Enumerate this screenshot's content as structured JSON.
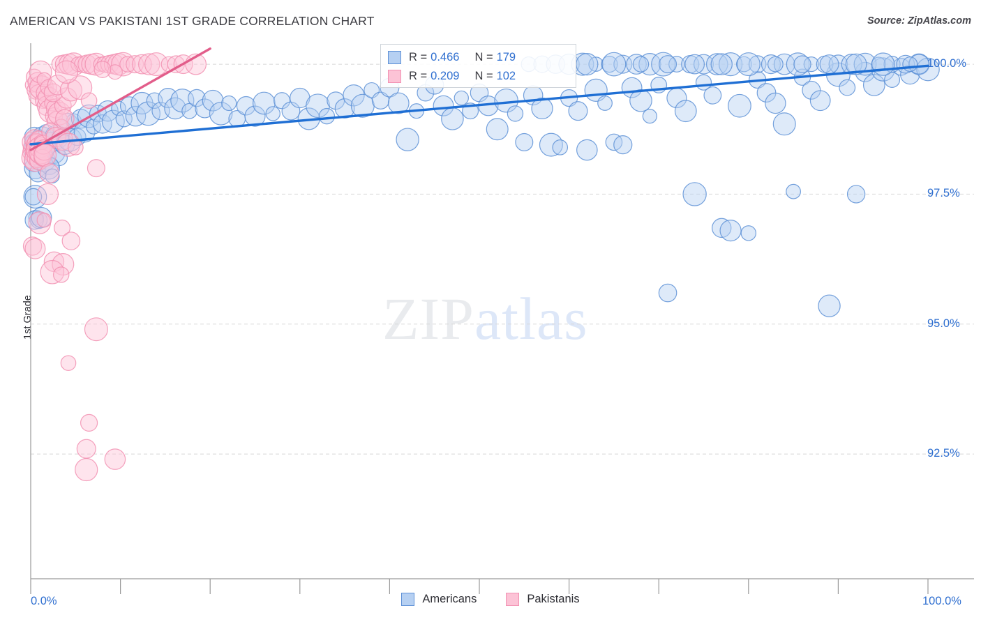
{
  "title": "AMERICAN VS PAKISTANI 1ST GRADE CORRELATION CHART",
  "source": "Source: ZipAtlas.com",
  "watermark": {
    "part1": "ZIP",
    "part2": "atlas"
  },
  "legend_stats": {
    "rows": [
      {
        "series": "Americans",
        "color": "#b6d0f2",
        "border": "#5d90d6",
        "r_label": "R =",
        "r_value": "0.466",
        "n_label": "N =",
        "n_value": "179"
      },
      {
        "series": "Pakistanis",
        "color": "#fcc3d6",
        "border": "#f291b2",
        "r_label": "R =",
        "r_value": "0.209",
        "n_label": "N =",
        "n_value": "102"
      }
    ]
  },
  "bottom_legend": [
    {
      "label": "Americans",
      "color": "#b6d0f2",
      "border": "#5d90d6"
    },
    {
      "label": "Pakistanis",
      "color": "#fcc3d6",
      "border": "#f291b2"
    }
  ],
  "axes": {
    "y_title": "1st Grade",
    "y_ticks": [
      "100.0%",
      "97.5%",
      "95.0%",
      "92.5%"
    ],
    "x_ticks": [
      "0.0%",
      "100.0%"
    ]
  },
  "chart_data": {
    "type": "scatter",
    "title": "AMERICAN VS PAKISTANI 1ST GRADE CORRELATION CHART",
    "xlabel": "",
    "ylabel": "1st Grade",
    "xlim": [
      0,
      100
    ],
    "ylim": [
      90.1,
      100.35
    ],
    "grid": true,
    "legend_position": "bottom",
    "y_gridlines": [
      100.0,
      97.5,
      95.0,
      92.5
    ],
    "x_tick_values": [
      0,
      10,
      20,
      30,
      40,
      50,
      60,
      70,
      80,
      90,
      100
    ],
    "series": [
      {
        "name": "Americans",
        "color": "#b6d0f2",
        "border": "#5d90d6",
        "R": 0.466,
        "N": 179,
        "trendline": {
          "x0": 0,
          "y0": 98.46,
          "x1": 100,
          "y1": 99.97,
          "color": "#1f6fd4"
        },
        "points": [
          [
            0.1,
            98.3
          ],
          [
            0.2,
            98.5
          ],
          [
            0.3,
            98.1
          ],
          [
            0.4,
            98.6
          ],
          [
            0.5,
            98.0
          ],
          [
            0.6,
            98.45
          ],
          [
            0.7,
            98.25
          ],
          [
            0.8,
            97.9
          ],
          [
            0.9,
            98.55
          ],
          [
            1.0,
            98.35
          ],
          [
            0.5,
            97.45
          ],
          [
            0.6,
            97.05
          ],
          [
            0.9,
            97.0
          ],
          [
            1.1,
            98.2
          ],
          [
            1.3,
            98.6
          ],
          [
            1.5,
            98.15
          ],
          [
            1.7,
            98.7
          ],
          [
            1.9,
            98.4
          ],
          [
            2.1,
            98.05
          ],
          [
            2.3,
            98.5
          ],
          [
            2.6,
            98.3
          ],
          [
            2.9,
            98.6
          ],
          [
            3.2,
            98.2
          ],
          [
            3.5,
            98.75
          ],
          [
            3.8,
            98.45
          ],
          [
            4.1,
            98.85
          ],
          [
            4.4,
            98.55
          ],
          [
            4.8,
            98.9
          ],
          [
            5.2,
            98.6
          ],
          [
            5.6,
            98.95
          ],
          [
            6.0,
            98.7
          ],
          [
            6.5,
            99.0
          ],
          [
            7.0,
            98.8
          ],
          [
            7.5,
            99.05
          ],
          [
            8.0,
            98.85
          ],
          [
            8.6,
            99.1
          ],
          [
            9.2,
            98.9
          ],
          [
            9.8,
            99.15
          ],
          [
            10.4,
            98.95
          ],
          [
            11.0,
            99.2
          ],
          [
            11.7,
            99.0
          ],
          [
            12.4,
            99.25
          ],
          [
            13.1,
            99.05
          ],
          [
            13.8,
            99.3
          ],
          [
            14.5,
            99.1
          ],
          [
            15.3,
            99.35
          ],
          [
            16.1,
            99.15
          ],
          [
            16.9,
            99.3
          ],
          [
            17.7,
            99.1
          ],
          [
            18.5,
            99.35
          ],
          [
            19.4,
            99.15
          ],
          [
            20.3,
            99.3
          ],
          [
            21.2,
            99.05
          ],
          [
            22.1,
            99.25
          ],
          [
            23.0,
            98.95
          ],
          [
            24.0,
            99.2
          ],
          [
            25.0,
            99.0
          ],
          [
            26.0,
            99.25
          ],
          [
            27.0,
            99.05
          ],
          [
            28.0,
            99.3
          ],
          [
            29.0,
            99.1
          ],
          [
            30.0,
            99.35
          ],
          [
            31.0,
            98.95
          ],
          [
            32.0,
            99.2
          ],
          [
            33.0,
            99.0
          ],
          [
            34.0,
            99.3
          ],
          [
            35.0,
            99.15
          ],
          [
            36.0,
            99.4
          ],
          [
            37.0,
            99.2
          ],
          [
            38.0,
            99.5
          ],
          [
            39.0,
            99.3
          ],
          [
            40.0,
            99.55
          ],
          [
            41.0,
            99.25
          ],
          [
            42.0,
            98.55
          ],
          [
            43.0,
            99.1
          ],
          [
            44.0,
            99.45
          ],
          [
            45.0,
            99.6
          ],
          [
            46.0,
            99.2
          ],
          [
            47.0,
            98.95
          ],
          [
            48.0,
            99.35
          ],
          [
            49.0,
            99.1
          ],
          [
            50.0,
            99.45
          ],
          [
            51.0,
            99.2
          ],
          [
            52.0,
            98.75
          ],
          [
            53.0,
            99.3
          ],
          [
            54.0,
            99.05
          ],
          [
            55.0,
            98.5
          ],
          [
            56.0,
            99.4
          ],
          [
            57.0,
            99.15
          ],
          [
            58.0,
            98.45
          ],
          [
            59.0,
            98.4
          ],
          [
            60.0,
            99.35
          ],
          [
            61.0,
            99.1
          ],
          [
            62.0,
            98.35
          ],
          [
            63.0,
            99.5
          ],
          [
            64.0,
            99.25
          ],
          [
            65.0,
            98.5
          ],
          [
            66.0,
            98.45
          ],
          [
            67.0,
            99.55
          ],
          [
            68.0,
            99.3
          ],
          [
            69.0,
            99.0
          ],
          [
            70.0,
            99.6
          ],
          [
            71.0,
            95.6
          ],
          [
            72.0,
            99.35
          ],
          [
            73.0,
            99.1
          ],
          [
            74.0,
            97.5
          ],
          [
            75.0,
            99.65
          ],
          [
            76.0,
            99.4
          ],
          [
            77.0,
            96.85
          ],
          [
            78.0,
            96.8
          ],
          [
            79.0,
            99.2
          ],
          [
            80.0,
            96.75
          ],
          [
            81.0,
            99.7
          ],
          [
            82.0,
            99.45
          ],
          [
            83.0,
            99.25
          ],
          [
            84.0,
            98.85
          ],
          [
            85.0,
            97.55
          ],
          [
            86.0,
            99.75
          ],
          [
            87.0,
            99.5
          ],
          [
            88.0,
            99.3
          ],
          [
            89.0,
            95.35
          ],
          [
            90.0,
            99.8
          ],
          [
            91.0,
            99.55
          ],
          [
            92.0,
            97.5
          ],
          [
            93.0,
            99.85
          ],
          [
            94.0,
            99.6
          ],
          [
            95.0,
            99.9
          ],
          [
            96.0,
            99.7
          ],
          [
            97.0,
            99.95
          ],
          [
            98.0,
            99.8
          ],
          [
            99.0,
            100.0
          ],
          [
            100.0,
            99.9
          ],
          [
            55.5,
            100.0
          ],
          [
            57.0,
            100.0
          ],
          [
            58.5,
            100.0
          ],
          [
            60.0,
            100.0
          ],
          [
            61.5,
            100.0
          ],
          [
            63.0,
            100.0
          ],
          [
            64.5,
            100.0
          ],
          [
            66.0,
            100.0
          ],
          [
            67.5,
            100.0
          ],
          [
            69.0,
            100.0
          ],
          [
            70.5,
            100.0
          ],
          [
            72.0,
            100.0
          ],
          [
            73.5,
            100.0
          ],
          [
            75.0,
            100.0
          ],
          [
            76.5,
            100.0
          ],
          [
            78.0,
            100.0
          ],
          [
            79.5,
            100.0
          ],
          [
            81.0,
            100.0
          ],
          [
            82.5,
            100.0
          ],
          [
            84.0,
            100.0
          ],
          [
            85.5,
            100.0
          ],
          [
            87.0,
            100.0
          ],
          [
            88.5,
            100.0
          ],
          [
            90.0,
            100.0
          ],
          [
            91.5,
            100.0
          ],
          [
            93.0,
            100.0
          ],
          [
            94.5,
            100.0
          ],
          [
            96.0,
            100.0
          ],
          [
            97.5,
            100.0
          ],
          [
            99.0,
            100.0
          ],
          [
            62.0,
            100.0
          ],
          [
            65.0,
            100.0
          ],
          [
            68.0,
            100.0
          ],
          [
            71.0,
            100.0
          ],
          [
            74.0,
            100.0
          ],
          [
            77.0,
            100.0
          ],
          [
            80.0,
            100.0
          ],
          [
            83.0,
            100.0
          ],
          [
            86.0,
            100.0
          ],
          [
            89.0,
            100.0
          ],
          [
            92.0,
            100.0
          ],
          [
            95.0,
            100.0
          ],
          [
            98.0,
            100.0
          ],
          [
            0.3,
            97.45
          ],
          [
            0.4,
            97.0
          ],
          [
            1.2,
            97.05
          ],
          [
            2.0,
            98.0
          ],
          [
            2.4,
            97.85
          ]
        ]
      },
      {
        "name": "Pakistanis",
        "color": "#fcc3d6",
        "border": "#f291b2",
        "R": 0.209,
        "N": 102,
        "trendline": {
          "x0": 0,
          "y0": 98.35,
          "x1": 20.0,
          "y1": 100.3,
          "color": "#e25d8a"
        },
        "points": [
          [
            0.1,
            98.4
          ],
          [
            0.15,
            98.3
          ],
          [
            0.2,
            98.5
          ],
          [
            0.25,
            98.2
          ],
          [
            0.3,
            98.45
          ],
          [
            0.35,
            98.35
          ],
          [
            0.4,
            98.25
          ],
          [
            0.45,
            98.55
          ],
          [
            0.5,
            98.15
          ],
          [
            0.55,
            98.4
          ],
          [
            0.6,
            98.3
          ],
          [
            0.65,
            98.5
          ],
          [
            0.7,
            98.2
          ],
          [
            0.75,
            98.45
          ],
          [
            0.8,
            98.35
          ],
          [
            0.85,
            98.25
          ],
          [
            0.9,
            98.55
          ],
          [
            0.95,
            98.15
          ],
          [
            1.0,
            98.4
          ],
          [
            1.1,
            98.3
          ],
          [
            1.2,
            98.5
          ],
          [
            1.3,
            98.2
          ],
          [
            1.4,
            98.45
          ],
          [
            1.5,
            98.35
          ],
          [
            1.6,
            98.25
          ],
          [
            0.2,
            99.6
          ],
          [
            0.4,
            99.75
          ],
          [
            0.6,
            99.5
          ],
          [
            0.8,
            99.65
          ],
          [
            1.0,
            99.4
          ],
          [
            1.2,
            99.55
          ],
          [
            1.4,
            99.3
          ],
          [
            1.6,
            99.45
          ],
          [
            1.8,
            99.2
          ],
          [
            2.0,
            99.35
          ],
          [
            2.2,
            99.1
          ],
          [
            2.4,
            99.25
          ],
          [
            2.6,
            99.0
          ],
          [
            2.8,
            99.15
          ],
          [
            3.0,
            98.9
          ],
          [
            3.2,
            99.05
          ],
          [
            3.4,
            98.8
          ],
          [
            3.6,
            99.2
          ],
          [
            3.8,
            98.95
          ],
          [
            4.0,
            99.35
          ],
          [
            1.1,
            99.85
          ],
          [
            1.5,
            99.7
          ],
          [
            2.0,
            99.55
          ],
          [
            2.5,
            99.45
          ],
          [
            3.0,
            99.6
          ],
          [
            4.5,
            99.5
          ],
          [
            5.5,
            99.55
          ],
          [
            6.5,
            99.3
          ],
          [
            2.2,
            98.7
          ],
          [
            2.8,
            98.6
          ],
          [
            3.5,
            98.55
          ],
          [
            4.2,
            98.45
          ],
          [
            5.0,
            98.4
          ],
          [
            3.3,
            100.0
          ],
          [
            3.8,
            100.0
          ],
          [
            4.3,
            100.0
          ],
          [
            4.8,
            100.0
          ],
          [
            5.3,
            100.0
          ],
          [
            5.8,
            100.0
          ],
          [
            6.3,
            100.0
          ],
          [
            6.8,
            100.0
          ],
          [
            7.3,
            100.0
          ],
          [
            7.8,
            100.0
          ],
          [
            8.3,
            100.0
          ],
          [
            8.8,
            100.0
          ],
          [
            9.3,
            100.0
          ],
          [
            9.8,
            100.0
          ],
          [
            10.3,
            100.0
          ],
          [
            10.8,
            100.0
          ],
          [
            11.6,
            100.0
          ],
          [
            12.4,
            100.0
          ],
          [
            13.2,
            100.0
          ],
          [
            14.0,
            100.0
          ],
          [
            15.4,
            100.0
          ],
          [
            16.2,
            100.0
          ],
          [
            17.0,
            100.0
          ],
          [
            18.4,
            100.0
          ],
          [
            4.0,
            99.85
          ],
          [
            9.4,
            99.85
          ],
          [
            8.0,
            99.9
          ],
          [
            0.2,
            96.5
          ],
          [
            0.5,
            96.45
          ],
          [
            1.0,
            96.95
          ],
          [
            1.5,
            97.0
          ],
          [
            3.5,
            96.85
          ],
          [
            4.5,
            96.6
          ],
          [
            2.6,
            96.2
          ],
          [
            3.6,
            96.15
          ],
          [
            2.4,
            96.0
          ],
          [
            3.4,
            95.95
          ],
          [
            7.3,
            98.0
          ],
          [
            2.1,
            97.9
          ],
          [
            1.9,
            97.5
          ],
          [
            7.3,
            94.9
          ],
          [
            4.2,
            94.25
          ],
          [
            6.5,
            93.1
          ],
          [
            6.2,
            92.6
          ],
          [
            9.4,
            92.4
          ],
          [
            6.2,
            92.2
          ]
        ]
      }
    ]
  }
}
